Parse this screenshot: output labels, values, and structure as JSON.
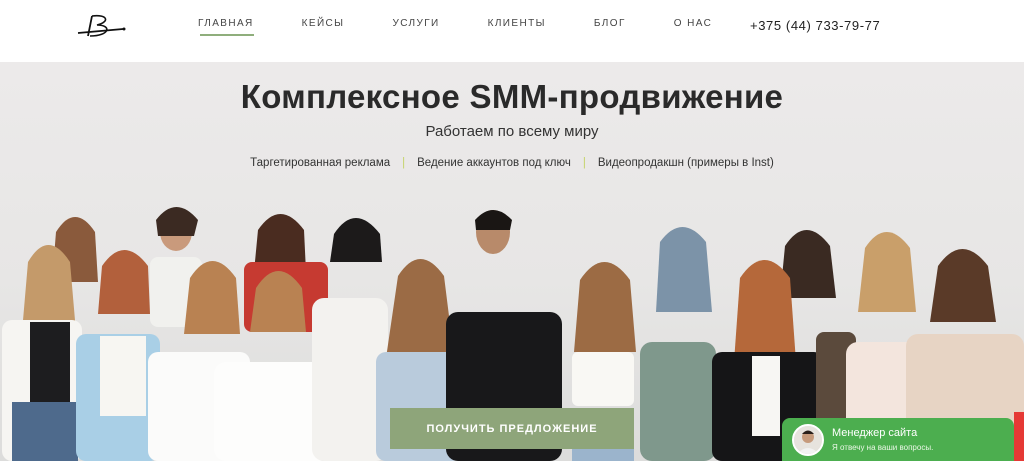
{
  "header": {
    "nav": [
      {
        "label": "ГЛАВНАЯ",
        "active": true
      },
      {
        "label": "КЕЙСЫ"
      },
      {
        "label": "УСЛУГИ"
      },
      {
        "label": "КЛИЕНТЫ"
      },
      {
        "label": "БЛОГ"
      },
      {
        "label": "О НАС"
      }
    ],
    "phone": "+375 (44) 733-79-77"
  },
  "hero": {
    "title": "Комплексное SMM-продвижение",
    "subtitle": "Работаем по всему миру",
    "services": [
      "Таргетированная реклама",
      "Ведение аккаунтов под ключ",
      "Видеопродакшн (примеры в Inst)"
    ],
    "services_separator": "|",
    "cta": "ПОЛУЧИТЬ ПРЕДЛОЖЕНИЕ"
  },
  "chat": {
    "name": "Менеджер сайта",
    "subtitle": "Я отвечу на ваши вопросы."
  },
  "colors": {
    "accent": "#8ea57a",
    "nav_underline": "#8fae7c",
    "separator": "#c5d36a",
    "chat": "#4cae4f"
  },
  "icons": [
    "logo-icon",
    "avatar"
  ]
}
